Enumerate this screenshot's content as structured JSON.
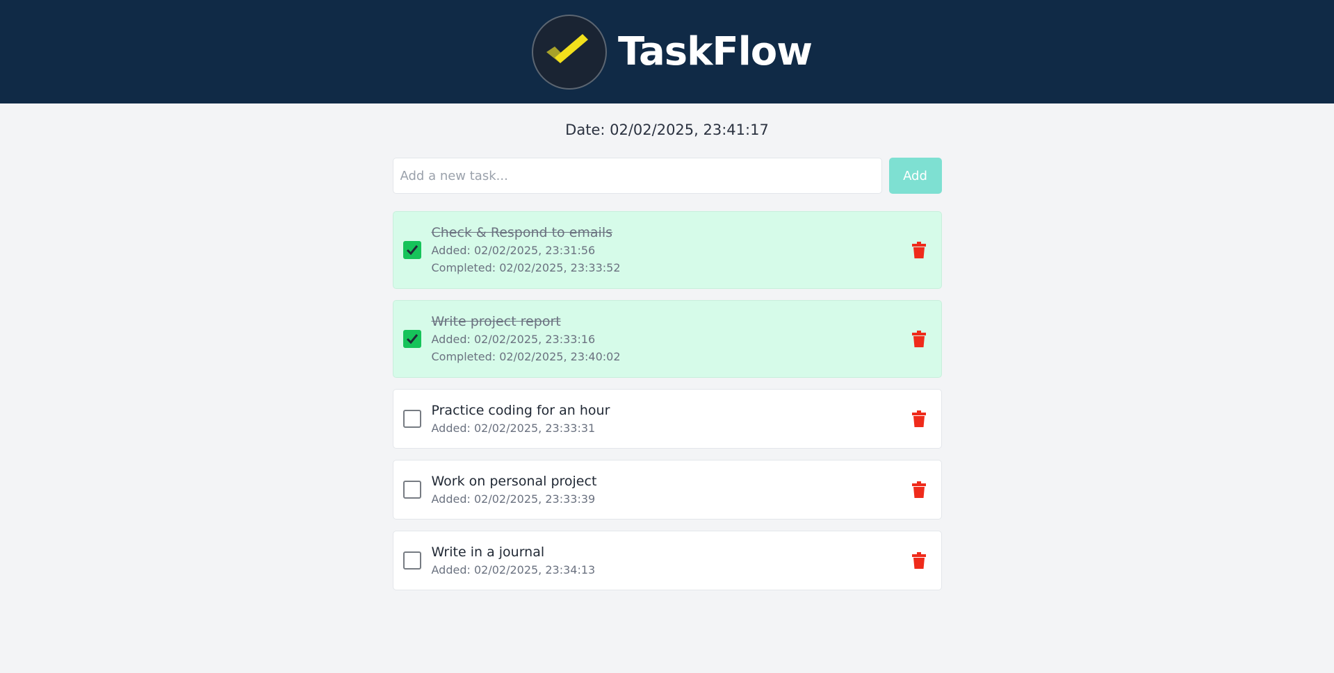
{
  "app": {
    "title": "TaskFlow",
    "logo_icon": "check-logo-icon",
    "header_bg": "#102a46"
  },
  "date_text": "Date: 02/02/2025, 23:41:17",
  "new_task": {
    "placeholder": "Add a new task...",
    "value": "",
    "add_label": "Add"
  },
  "colors": {
    "accent": "#7ee0d2",
    "done_bg": "#d6fbe9",
    "checked": "#16c35a",
    "delete": "#ef2b1b"
  },
  "tasks": [
    {
      "title": "Check & Respond to emails",
      "added": "Added: 02/02/2025, 23:31:56",
      "completed": "Completed: 02/02/2025, 23:33:52",
      "done": true
    },
    {
      "title": "Write project report",
      "added": "Added: 02/02/2025, 23:33:16",
      "completed": "Completed: 02/02/2025, 23:40:02",
      "done": true
    },
    {
      "title": "Practice coding for an hour",
      "added": "Added: 02/02/2025, 23:33:31",
      "done": false
    },
    {
      "title": "Work on personal project",
      "added": "Added: 02/02/2025, 23:33:39",
      "done": false
    },
    {
      "title": "Write in a journal",
      "added": "Added: 02/02/2025, 23:34:13",
      "done": false
    }
  ]
}
